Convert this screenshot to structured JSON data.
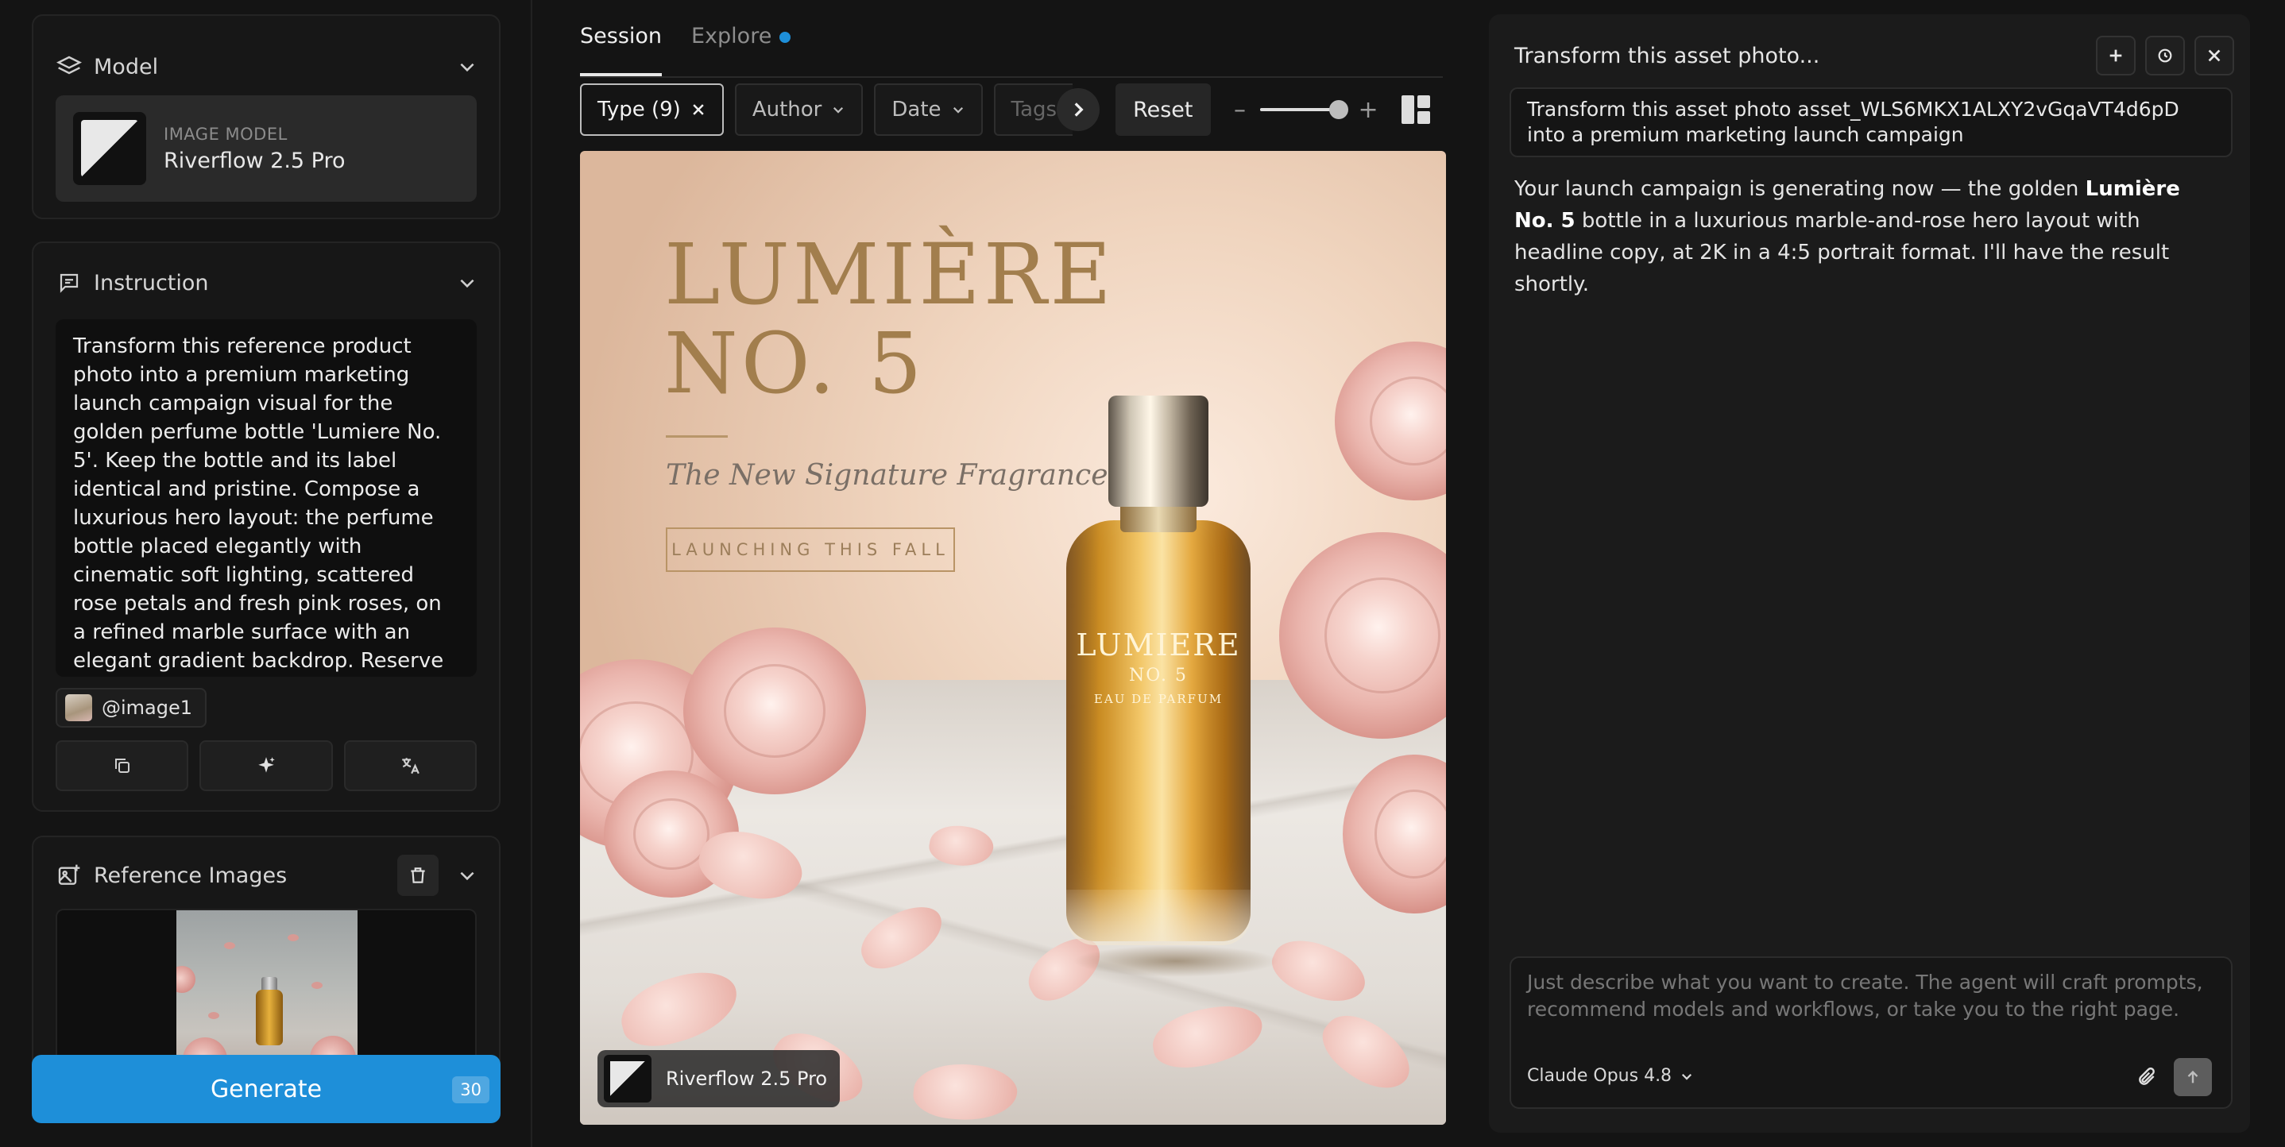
{
  "left": {
    "model_section": {
      "title": "Model",
      "sub_label": "IMAGE MODEL",
      "model_name": "Riverflow 2.5 Pro"
    },
    "instruction_section": {
      "title": "Instruction",
      "text": "Transform this reference product photo into a premium marketing launch campaign visual for the golden perfume bottle 'Lumiere No. 5'. Keep the bottle and its label identical and pristine. Compose a luxurious hero layout: the perfume bottle placed elegantly with cinematic soft lighting, scattered rose petals and fresh pink roses, on a refined marble surface with an elegant gradient backdrop. Reserve clean negative",
      "chip_label": "@image1"
    },
    "reference_section": {
      "title": "Reference Images"
    },
    "generate": {
      "label": "Generate",
      "count": "30"
    }
  },
  "center": {
    "tabs": [
      {
        "label": "Session"
      },
      {
        "label": "Explore"
      }
    ],
    "filters": {
      "type": "Type (9)",
      "author": "Author",
      "date": "Date",
      "tags": "Tags",
      "reset": "Reset"
    },
    "zoom_level": 0.9,
    "poster": {
      "title_line1": "LUMIÈRE",
      "title_line2": "NO. 5",
      "subtitle": "The New Signature Fragrance",
      "badge": "LAUNCHING THIS FALL",
      "bottle_label_1": "LUMIERE",
      "bottle_label_2": "NO. 5",
      "bottle_label_3": "EAU DE PARFUM",
      "model_tag": "Riverflow 2.5 Pro"
    }
  },
  "right": {
    "title": "Transform this asset photo...",
    "user_message": "Transform this asset photo asset_WLS6MKX1ALXY2vGqaVT4d6pD into a premium marketing launch campaign",
    "reply_before": "Your launch campaign is generating now — the golden ",
    "reply_bold": "Lumière No. 5",
    "reply_after": " bottle in a luxurious marble-and-rose hero layout with headline copy, at 2K in a 4:5 portrait format. I'll have the result shortly.",
    "composer_placeholder": "Just describe what you want to create. The agent will craft prompts, recommend models and workflows, or take you to the right page.",
    "composer_model": "Claude Opus 4.8"
  },
  "colors": {
    "accent": "#1e8fd9",
    "background": "#141414",
    "panel": "#1b1b1b",
    "gold": "#a27e4d"
  }
}
